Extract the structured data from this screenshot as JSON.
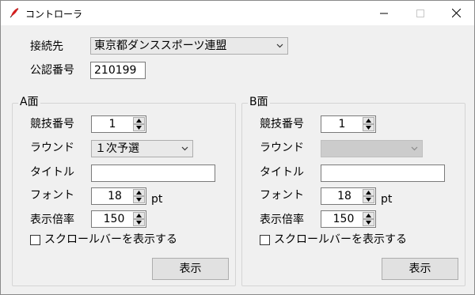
{
  "window": {
    "title": "コントローラ"
  },
  "connection": {
    "label": "接続先",
    "value": "東京都ダンススポーツ連盟",
    "cert_label": "公認番号",
    "cert_value": "210199"
  },
  "panels": [
    {
      "title": "A面",
      "event_label": "競技番号",
      "event_value": "1",
      "round_label": "ラウンド",
      "round_value": "１次予選",
      "round_disabled": false,
      "title_label": "タイトル",
      "title_value": "",
      "font_label": "フォント",
      "font_value": "18",
      "font_unit": "pt",
      "zoom_label": "表示倍率",
      "zoom_value": "150",
      "scrollbar_label": "スクロールバーを表示する",
      "scrollbar_checked": false,
      "show_button": "表示"
    },
    {
      "title": "B面",
      "event_label": "競技番号",
      "event_value": "1",
      "round_label": "ラウンド",
      "round_value": "",
      "round_disabled": true,
      "title_label": "タイトル",
      "title_value": "",
      "font_label": "フォント",
      "font_value": "18",
      "font_unit": "pt",
      "zoom_label": "表示倍率",
      "zoom_value": "150",
      "scrollbar_label": "スクロールバーを表示する",
      "scrollbar_checked": false,
      "show_button": "表示"
    }
  ]
}
